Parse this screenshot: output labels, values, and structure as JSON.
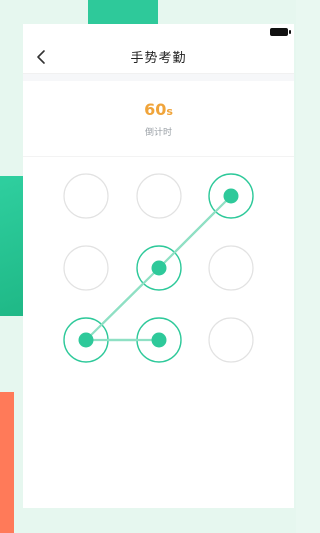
{
  "header": {
    "title": "手势考勤"
  },
  "timer": {
    "value": "60",
    "unit": "s",
    "label": "倒计时"
  },
  "pattern": {
    "grid_rows": 3,
    "grid_cols": 3,
    "selected_sequence": [
      {
        "row": 1,
        "col": 3
      },
      {
        "row": 2,
        "col": 2
      },
      {
        "row": 3,
        "col": 1
      },
      {
        "row": 3,
        "col": 2
      }
    ]
  },
  "icons": {
    "back": "chevron-left-icon",
    "battery": "battery-icon"
  },
  "colors": {
    "accent_green": "#2ec99a",
    "timer_orange": "#f0a43a",
    "inactive_ring": "#e2e2e2"
  }
}
